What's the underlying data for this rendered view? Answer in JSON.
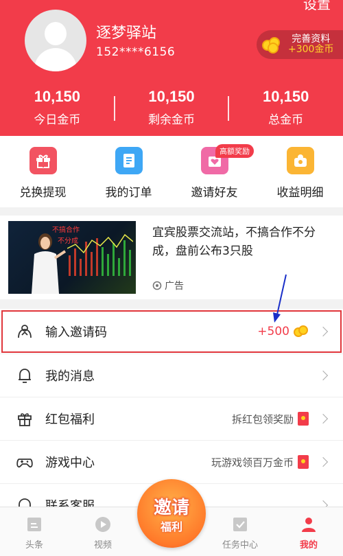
{
  "header": {
    "settings_label": "设置",
    "username": "逐梦驿站",
    "phone": "152****6156",
    "profile_btn": {
      "line1": "完善资料",
      "line2": "+300金币"
    },
    "stats": [
      {
        "value": "10,150",
        "label": "今日金币"
      },
      {
        "value": "10,150",
        "label": "剩余金币"
      },
      {
        "value": "10,150",
        "label": "总金币"
      }
    ]
  },
  "quick_actions": [
    {
      "label": "兑换提现",
      "icon": "gift-icon",
      "color": "#f25361"
    },
    {
      "label": "我的订单",
      "icon": "order-icon",
      "color": "#3ea7f5"
    },
    {
      "label": "邀请好友",
      "icon": "invite-icon",
      "color": "#f06aa6",
      "badge": "高额奖励"
    },
    {
      "label": "收益明细",
      "icon": "wallet-icon",
      "color": "#fbb534"
    }
  ],
  "ad": {
    "title": "宜宾股票交流站，不搞合作不分成，盘前公布3只股",
    "label": "广告",
    "img_text1": "不搞合作",
    "img_text2": "不分成"
  },
  "list": [
    {
      "label": "输入邀请码",
      "right": "+500",
      "icon": "invite-code-icon",
      "accessory": "coin"
    },
    {
      "label": "我的消息",
      "right": "",
      "icon": "bell-icon",
      "accessory": ""
    },
    {
      "label": "红包福利",
      "right": "拆红包领奖励",
      "icon": "gift-box-icon",
      "accessory": "redbag"
    },
    {
      "label": "游戏中心",
      "right": "玩游戏领百万金币",
      "icon": "gamepad-icon",
      "accessory": "redbag"
    },
    {
      "label": "联系客服",
      "right": "",
      "icon": "headset-icon",
      "accessory": ""
    }
  ],
  "float_btn": {
    "line1": "邀请",
    "line2": "福利"
  },
  "nav": [
    {
      "label": "头条",
      "icon": "news-icon",
      "active": false
    },
    {
      "label": "视频",
      "icon": "video-icon",
      "active": false
    },
    {
      "label": "",
      "icon": "",
      "active": false
    },
    {
      "label": "任务中心",
      "icon": "task-icon",
      "active": false
    },
    {
      "label": "我的",
      "icon": "profile-icon",
      "active": true
    }
  ],
  "colors": {
    "primary": "#f23c4a",
    "gold": "#ffd21f",
    "annotation": "#1a2fc8"
  }
}
